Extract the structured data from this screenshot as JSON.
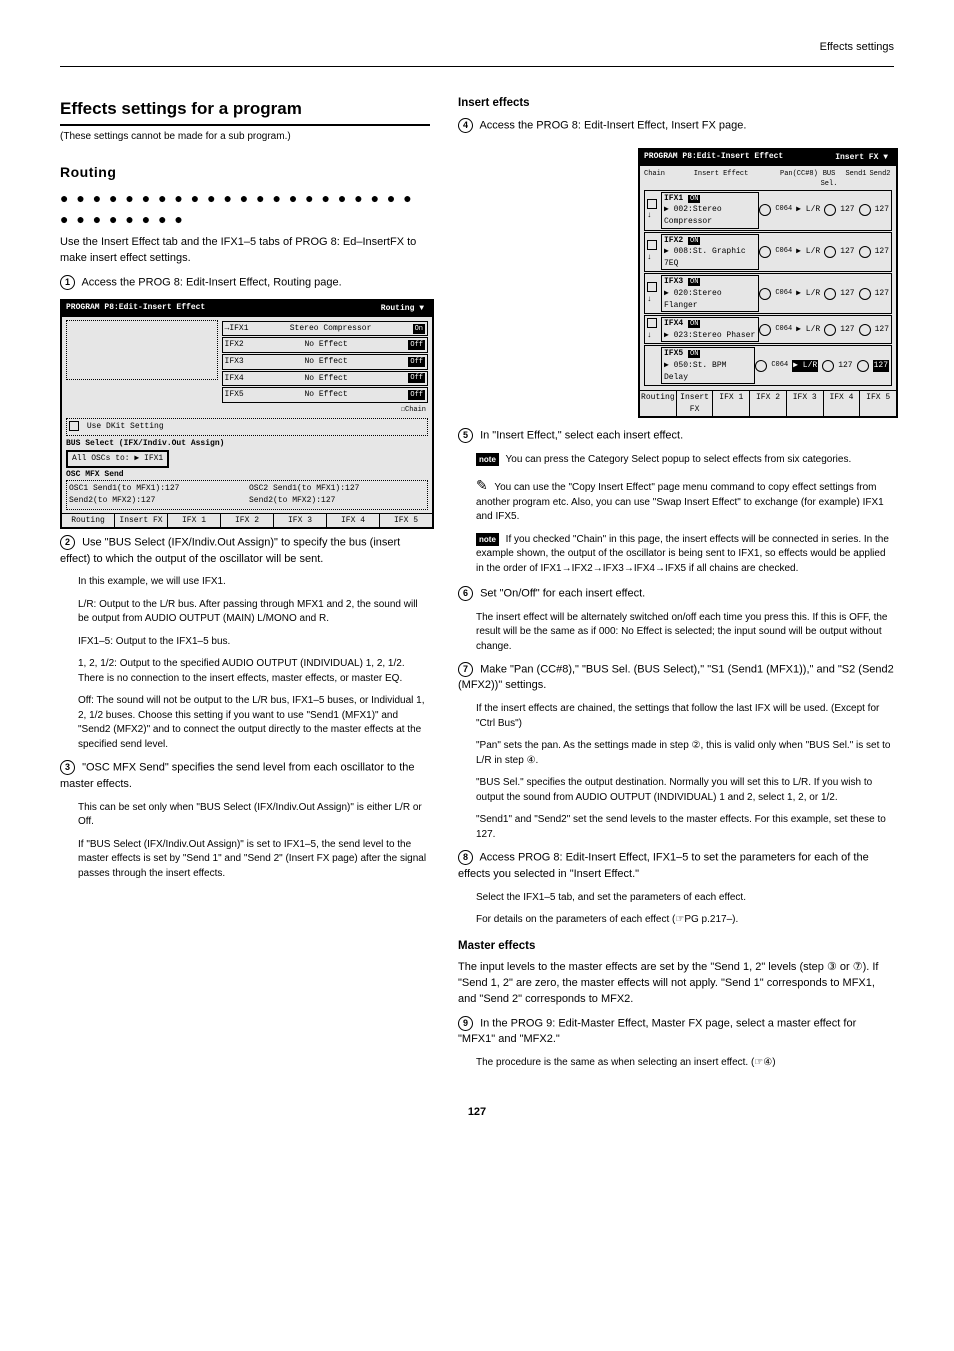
{
  "header": "Effects settings",
  "title": "Effects settings for a program",
  "title_note": "(These settings cannot be made for a sub program.)",
  "routing": {
    "heading": "Routing",
    "dots": "● ● ● ● ● ● ● ● ● ● ● ● ● ● ● ● ● ● ● ● ● ● ● ● ● ● ● ● ● ●",
    "intro": "Use the Insert Effect tab and the IFX1–5 tabs of PROG 8: Ed–InsertFX to make insert effect settings.",
    "step1": "Access the PROG 8: Edit-Insert Effect, Routing page.",
    "lcd1": {
      "title_left": "PROGRAM P8:Edit-Insert Effect",
      "title_right": "Routing ▼",
      "rows": [
        {
          "slot": "IFX1",
          "name": "Stereo Compressor",
          "on": "On"
        },
        {
          "slot": "IFX2",
          "name": "No Effect",
          "on": "Off"
        },
        {
          "slot": "IFX3",
          "name": "No Effect",
          "on": "Off"
        },
        {
          "slot": "IFX4",
          "name": "No Effect",
          "on": "Off"
        },
        {
          "slot": "IFX5",
          "name": "No Effect",
          "on": "Off"
        }
      ],
      "use_dkit": "Use DKit Setting",
      "bus_header": "BUS Select (IFX/Indiv.Out Assign)",
      "bus_value": "All OSCs to: ▶ IFX1",
      "mfx_header": "OSC MFX Send",
      "osc1_s1": "OSC1 Send1(to MFX1):127",
      "osc2_s1": "OSC2 Send1(to MFX1):127",
      "osc1_s2": "Send2(to MFX2):127",
      "osc2_s2": "Send2(to MFX2):127",
      "tabs": [
        "Routing",
        "Insert FX",
        "IFX 1",
        "IFX 2",
        "IFX 3",
        "IFX 4",
        "IFX 5"
      ]
    },
    "step2_a": "Use \"BUS Select (IFX/Indiv.Out Assign)\" to specify the bus (insert effect) to which the output of the oscillator will be sent.",
    "step2_b": "In this example, we will use IFX1.",
    "busdef": {
      "LR": "L/R: Output to the L/R bus. After passing through MFX1 and 2, the sound will be output from AUDIO OUTPUT (MAIN) L/MONO and R.",
      "IFX": "IFX1–5: Output to the IFX1–5 bus.",
      "N12": "1, 2, 1/2: Output to the specified AUDIO OUTPUT (INDIVIDUAL) 1, 2, 1/2. There is no connection to the insert effects, master effects, or master EQ.",
      "Off": "Off: The sound will not be output to the L/R bus, IFX1–5 buses, or Individual 1, 2, 1/2 buses. Choose this setting if you want to use \"Send1 (MFX1)\" and \"Send2 (MFX2)\" and to connect the output directly to the master effects at the specified send level."
    },
    "step3_a": "\"OSC MFX Send\" specifies the send level from each oscillator to the master effects.",
    "step3_b": "This can be set only when \"BUS Select (IFX/Indiv.Out Assign)\" is either L/R or Off.",
    "step3_c": "If \"BUS Select (IFX/Indiv.Out Assign)\" is set to IFX1–5, the send level to the master effects is set by \"Send 1\" and \"Send 2\" (Insert FX page) after the signal passes through the insert effects."
  },
  "insertfx": {
    "heading": "Insert effects",
    "step4": "Access the PROG 8: Edit-Insert Effect, Insert FX page.",
    "lcd2": {
      "title_left": "PROGRAM P8:Edit-Insert Effect",
      "title_right": "Insert FX ▼",
      "cols": [
        "Chain",
        "Insert Effect",
        "Pan(CC#8)",
        "BUS Sel.",
        "Send1",
        "Send2"
      ],
      "rows": [
        {
          "slot": "IFX1",
          "name": "002:Stereo Compressor",
          "on": "ON",
          "pan": "C064",
          "bus": "▶ L/R",
          "s1": "127",
          "s2": "127"
        },
        {
          "slot": "IFX2",
          "name": "008:St. Graphic 7EQ",
          "on": "ON",
          "pan": "C064",
          "bus": "▶ L/R",
          "s1": "127",
          "s2": "127"
        },
        {
          "slot": "IFX3",
          "name": "020:Stereo Flanger",
          "on": "ON",
          "pan": "C064",
          "bus": "▶ L/R",
          "s1": "127",
          "s2": "127"
        },
        {
          "slot": "IFX4",
          "name": "023:Stereo Phaser",
          "on": "ON",
          "pan": "C064",
          "bus": "▶ L/R",
          "s1": "127",
          "s2": "127"
        },
        {
          "slot": "IFX5",
          "name": "050:St. BPM Delay",
          "on": "ON",
          "pan": "C064",
          "bus": "▶ L/R",
          "s1": "127",
          "s2": "127"
        }
      ],
      "tabs": [
        "Routing",
        "Insert FX",
        "IFX 1",
        "IFX 2",
        "IFX 3",
        "IFX 4",
        "IFX 5"
      ]
    },
    "step5": "In \"Insert Effect,\" select each insert effect.",
    "note5a": "You can press the Category Select popup to select effects from six categories.",
    "note5b_pencil": "You can use the \"Copy Insert Effect\" page menu command to copy effect settings from another program etc. Also, you can use \"Swap Insert Effect\" to exchange (for example) IFX1 and IFX5.",
    "note5c": "If you checked \"Chain\" in this page, the insert effects will be connected in series. In the example shown, the output of the oscillator is being sent to IFX1, so effects would be applied in the order of IFX1→IFX2→IFX3→IFX4→IFX5 if all chains are checked.",
    "step6": "Set \"On/Off\" for each insert effect.",
    "step6b": "The insert effect will be alternately switched on/off each time you press this. If this is OFF, the result will be the same as if 000: No Effect is selected; the input sound will be output without change.",
    "step7": "Make \"Pan (CC#8),\" \"BUS Sel. (BUS Select),\" \"S1 (Send1 (MFX1)),\" and \"S2 (Send2 (MFX2))\" settings.",
    "step7b": "If the insert effects are chained, the settings that follow the last IFX will be used. (Except for \"Ctrl Bus\")",
    "step7_c": "\"Pan\" sets the pan. As the settings made in step ②, this is valid only when \"BUS Sel.\" is set to L/R in step ④.",
    "step7_d": "\"BUS Sel.\" specifies the output destination. Normally you will set this to L/R. If you wish to output the sound from AUDIO OUTPUT (INDIVIDUAL) 1 and 2, select 1, 2, or 1/2.",
    "step7_e": "\"Send1\" and \"Send2\" set the send levels to the master effects. For this example, set these to 127.",
    "step8": "Access PROG 8: Edit-Insert Effect, IFX1–5 to set the parameters for each of the effects you selected in \"Insert Effect.\"",
    "step8b": "Select the IFX1–5 tab, and set the parameters of each effect.",
    "step8c": "For details on the parameters of each effect (☞PG p.217–).",
    "mstfx_heading": "Master effects",
    "mstfx_intro": "The input levels to the master effects are set by the \"Send 1, 2\" levels (step ③ or ⑦). If \"Send 1, 2\" are zero, the master effects will not apply. \"Send 1\" corresponds to MFX1, and \"Send 2\" corresponds to MFX2.",
    "step9": "In the PROG 9: Edit-Master Effect, Master FX page, select a master effect for \"MFX1\" and \"MFX2.\"",
    "step9b": "The procedure is the same as when selecting an insert effect. (☞④)"
  },
  "pagenum": "127"
}
